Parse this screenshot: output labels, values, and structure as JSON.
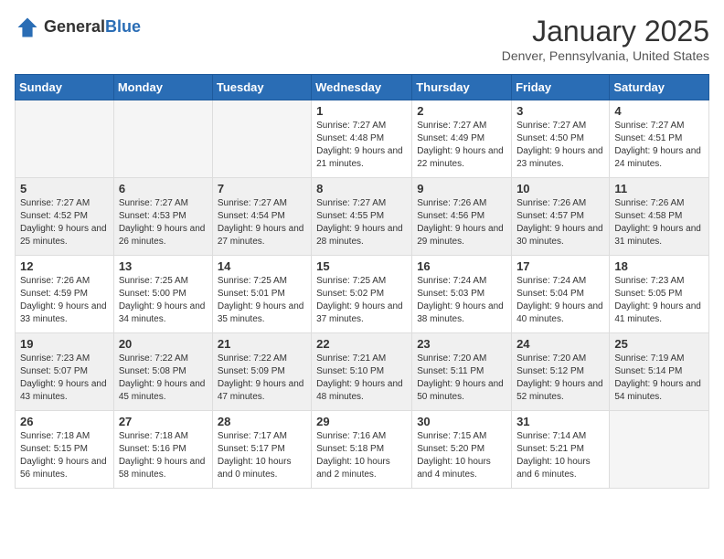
{
  "logo": {
    "general": "General",
    "blue": "Blue"
  },
  "title": "January 2025",
  "location": "Denver, Pennsylvania, United States",
  "days_header": [
    "Sunday",
    "Monday",
    "Tuesday",
    "Wednesday",
    "Thursday",
    "Friday",
    "Saturday"
  ],
  "weeks": [
    {
      "shaded": false,
      "days": [
        {
          "num": "",
          "info": ""
        },
        {
          "num": "",
          "info": ""
        },
        {
          "num": "",
          "info": ""
        },
        {
          "num": "1",
          "info": "Sunrise: 7:27 AM\nSunset: 4:48 PM\nDaylight: 9 hours and 21 minutes."
        },
        {
          "num": "2",
          "info": "Sunrise: 7:27 AM\nSunset: 4:49 PM\nDaylight: 9 hours and 22 minutes."
        },
        {
          "num": "3",
          "info": "Sunrise: 7:27 AM\nSunset: 4:50 PM\nDaylight: 9 hours and 23 minutes."
        },
        {
          "num": "4",
          "info": "Sunrise: 7:27 AM\nSunset: 4:51 PM\nDaylight: 9 hours and 24 minutes."
        }
      ]
    },
    {
      "shaded": true,
      "days": [
        {
          "num": "5",
          "info": "Sunrise: 7:27 AM\nSunset: 4:52 PM\nDaylight: 9 hours and 25 minutes."
        },
        {
          "num": "6",
          "info": "Sunrise: 7:27 AM\nSunset: 4:53 PM\nDaylight: 9 hours and 26 minutes."
        },
        {
          "num": "7",
          "info": "Sunrise: 7:27 AM\nSunset: 4:54 PM\nDaylight: 9 hours and 27 minutes."
        },
        {
          "num": "8",
          "info": "Sunrise: 7:27 AM\nSunset: 4:55 PM\nDaylight: 9 hours and 28 minutes."
        },
        {
          "num": "9",
          "info": "Sunrise: 7:26 AM\nSunset: 4:56 PM\nDaylight: 9 hours and 29 minutes."
        },
        {
          "num": "10",
          "info": "Sunrise: 7:26 AM\nSunset: 4:57 PM\nDaylight: 9 hours and 30 minutes."
        },
        {
          "num": "11",
          "info": "Sunrise: 7:26 AM\nSunset: 4:58 PM\nDaylight: 9 hours and 31 minutes."
        }
      ]
    },
    {
      "shaded": false,
      "days": [
        {
          "num": "12",
          "info": "Sunrise: 7:26 AM\nSunset: 4:59 PM\nDaylight: 9 hours and 33 minutes."
        },
        {
          "num": "13",
          "info": "Sunrise: 7:25 AM\nSunset: 5:00 PM\nDaylight: 9 hours and 34 minutes."
        },
        {
          "num": "14",
          "info": "Sunrise: 7:25 AM\nSunset: 5:01 PM\nDaylight: 9 hours and 35 minutes."
        },
        {
          "num": "15",
          "info": "Sunrise: 7:25 AM\nSunset: 5:02 PM\nDaylight: 9 hours and 37 minutes."
        },
        {
          "num": "16",
          "info": "Sunrise: 7:24 AM\nSunset: 5:03 PM\nDaylight: 9 hours and 38 minutes."
        },
        {
          "num": "17",
          "info": "Sunrise: 7:24 AM\nSunset: 5:04 PM\nDaylight: 9 hours and 40 minutes."
        },
        {
          "num": "18",
          "info": "Sunrise: 7:23 AM\nSunset: 5:05 PM\nDaylight: 9 hours and 41 minutes."
        }
      ]
    },
    {
      "shaded": true,
      "days": [
        {
          "num": "19",
          "info": "Sunrise: 7:23 AM\nSunset: 5:07 PM\nDaylight: 9 hours and 43 minutes."
        },
        {
          "num": "20",
          "info": "Sunrise: 7:22 AM\nSunset: 5:08 PM\nDaylight: 9 hours and 45 minutes."
        },
        {
          "num": "21",
          "info": "Sunrise: 7:22 AM\nSunset: 5:09 PM\nDaylight: 9 hours and 47 minutes."
        },
        {
          "num": "22",
          "info": "Sunrise: 7:21 AM\nSunset: 5:10 PM\nDaylight: 9 hours and 48 minutes."
        },
        {
          "num": "23",
          "info": "Sunrise: 7:20 AM\nSunset: 5:11 PM\nDaylight: 9 hours and 50 minutes."
        },
        {
          "num": "24",
          "info": "Sunrise: 7:20 AM\nSunset: 5:12 PM\nDaylight: 9 hours and 52 minutes."
        },
        {
          "num": "25",
          "info": "Sunrise: 7:19 AM\nSunset: 5:14 PM\nDaylight: 9 hours and 54 minutes."
        }
      ]
    },
    {
      "shaded": false,
      "days": [
        {
          "num": "26",
          "info": "Sunrise: 7:18 AM\nSunset: 5:15 PM\nDaylight: 9 hours and 56 minutes."
        },
        {
          "num": "27",
          "info": "Sunrise: 7:18 AM\nSunset: 5:16 PM\nDaylight: 9 hours and 58 minutes."
        },
        {
          "num": "28",
          "info": "Sunrise: 7:17 AM\nSunset: 5:17 PM\nDaylight: 10 hours and 0 minutes."
        },
        {
          "num": "29",
          "info": "Sunrise: 7:16 AM\nSunset: 5:18 PM\nDaylight: 10 hours and 2 minutes."
        },
        {
          "num": "30",
          "info": "Sunrise: 7:15 AM\nSunset: 5:20 PM\nDaylight: 10 hours and 4 minutes."
        },
        {
          "num": "31",
          "info": "Sunrise: 7:14 AM\nSunset: 5:21 PM\nDaylight: 10 hours and 6 minutes."
        },
        {
          "num": "",
          "info": ""
        }
      ]
    }
  ]
}
